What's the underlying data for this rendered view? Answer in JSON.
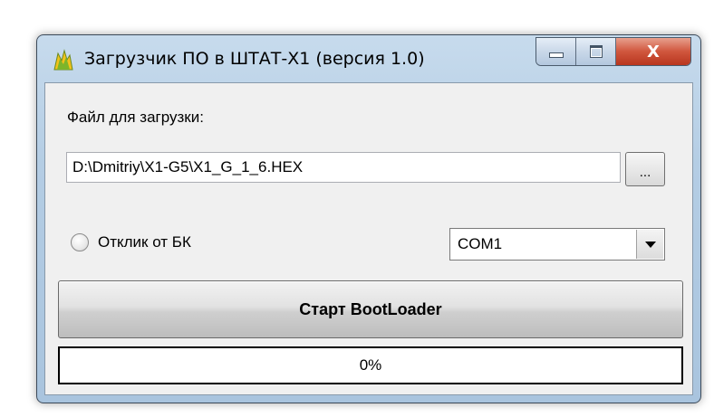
{
  "window": {
    "title": "Загрузчик ПО в ШТАТ-Х1 (версия 1.0)",
    "icon": "app-flame-icon",
    "close_label": "X",
    "accent_color": "#c9482f"
  },
  "form": {
    "file_label": "Файл для загрузки:",
    "file_path": "D:\\Dmitriy\\X1-G5\\X1_G_1_6.HEX",
    "browse_label": "...",
    "radio_label": "Отклик от БК",
    "radio_checked": false,
    "port_selected": "COM1",
    "start_label": "Старт BootLoader",
    "progress_text": "0%",
    "progress_value": 0
  }
}
